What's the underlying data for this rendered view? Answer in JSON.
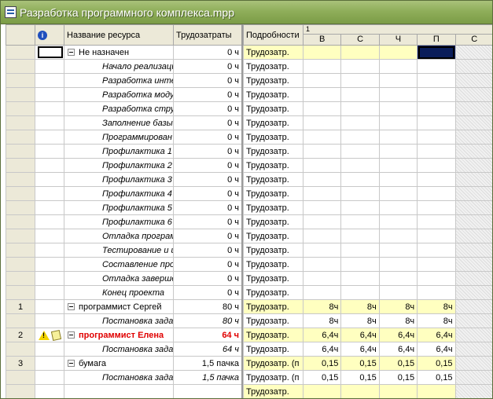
{
  "window": {
    "title": "Разработка программного комплекса.mpp"
  },
  "columns": {
    "indicator_icon": "info-icon",
    "name": "Название ресурса",
    "work": "Трудозатраты",
    "details": "Подробности",
    "week_number": "1",
    "days": [
      "В",
      "С",
      "Ч",
      "П",
      "С"
    ]
  },
  "rows": [
    {
      "id": "",
      "name": "Не назначен",
      "work": "0 ч",
      "detail": "Трудозатр.",
      "values": [
        "",
        "",
        "",
        ""
      ]
    },
    {
      "id": "",
      "name": "Начало реализаци",
      "work": "0 ч",
      "detail": "Трудозатр.",
      "values": [
        "",
        "",
        "",
        ""
      ]
    },
    {
      "id": "",
      "name": "Разработка инте",
      "work": "0 ч",
      "detail": "Трудозатр.",
      "values": [
        "",
        "",
        "",
        ""
      ]
    },
    {
      "id": "",
      "name": "Разработка моду",
      "work": "0 ч",
      "detail": "Трудозатр.",
      "values": [
        "",
        "",
        "",
        ""
      ]
    },
    {
      "id": "",
      "name": "Разработка стру",
      "work": "0 ч",
      "detail": "Трудозатр.",
      "values": [
        "",
        "",
        "",
        ""
      ]
    },
    {
      "id": "",
      "name": "Заполнение базы",
      "work": "0 ч",
      "detail": "Трудозатр.",
      "values": [
        "",
        "",
        "",
        ""
      ]
    },
    {
      "id": "",
      "name": "Программирован",
      "work": "0 ч",
      "detail": "Трудозатр.",
      "values": [
        "",
        "",
        "",
        ""
      ]
    },
    {
      "id": "",
      "name": "Профилактика 1",
      "work": "0 ч",
      "detail": "Трудозатр.",
      "values": [
        "",
        "",
        "",
        ""
      ]
    },
    {
      "id": "",
      "name": "Профилактика 2",
      "work": "0 ч",
      "detail": "Трудозатр.",
      "values": [
        "",
        "",
        "",
        ""
      ]
    },
    {
      "id": "",
      "name": "Профилактика 3",
      "work": "0 ч",
      "detail": "Трудозатр.",
      "values": [
        "",
        "",
        "",
        ""
      ]
    },
    {
      "id": "",
      "name": "Профилактика 4",
      "work": "0 ч",
      "detail": "Трудозатр.",
      "values": [
        "",
        "",
        "",
        ""
      ]
    },
    {
      "id": "",
      "name": "Профилактика 5",
      "work": "0 ч",
      "detail": "Трудозатр.",
      "values": [
        "",
        "",
        "",
        ""
      ]
    },
    {
      "id": "",
      "name": "Профилактика 6",
      "work": "0 ч",
      "detail": "Трудозатр.",
      "values": [
        "",
        "",
        "",
        ""
      ]
    },
    {
      "id": "",
      "name": "Отладка програм",
      "work": "0 ч",
      "detail": "Трудозатр.",
      "values": [
        "",
        "",
        "",
        ""
      ]
    },
    {
      "id": "",
      "name": "Тестирование и и",
      "work": "0 ч",
      "detail": "Трудозатр.",
      "values": [
        "",
        "",
        "",
        ""
      ]
    },
    {
      "id": "",
      "name": "Составление про",
      "work": "0 ч",
      "detail": "Трудозатр.",
      "values": [
        "",
        "",
        "",
        ""
      ]
    },
    {
      "id": "",
      "name": "Отладка заверше",
      "work": "0 ч",
      "detail": "Трудозатр.",
      "values": [
        "",
        "",
        "",
        ""
      ]
    },
    {
      "id": "",
      "name": "Конец проекта",
      "work": "0 ч",
      "detail": "Трудозатр.",
      "values": [
        "",
        "",
        "",
        ""
      ]
    },
    {
      "id": "1",
      "name": "программист Сергей",
      "work": "80 ч",
      "detail": "Трудозатр.",
      "values": [
        "8ч",
        "8ч",
        "8ч",
        "8ч"
      ]
    },
    {
      "id": "",
      "name": "Постановка задач",
      "work": "80 ч",
      "detail": "Трудозатр.",
      "values": [
        "8ч",
        "8ч",
        "8ч",
        "8ч"
      ]
    },
    {
      "id": "2",
      "name": "программист Елена",
      "work": "64 ч",
      "detail": "Трудозатр.",
      "values": [
        "6,4ч",
        "6,4ч",
        "6,4ч",
        "6,4ч"
      ]
    },
    {
      "id": "",
      "name": "Постановка задач",
      "work": "64 ч",
      "detail": "Трудозатр.",
      "values": [
        "6,4ч",
        "6,4ч",
        "6,4ч",
        "6,4ч"
      ]
    },
    {
      "id": "3",
      "name": "бумага",
      "work": "1,5 пачка",
      "detail": "Трудозатр. (п",
      "values": [
        "0,15",
        "0,15",
        "0,15",
        "0,15"
      ]
    },
    {
      "id": "",
      "name": "Постановка задач",
      "work": "1,5 пачка",
      "detail": "Трудозатр. (п",
      "values": [
        "0,15",
        "0,15",
        "0,15",
        "0,15"
      ]
    },
    {
      "id": "",
      "name": "",
      "work": "",
      "detail": "Трудозатр.",
      "values": [
        "",
        "",
        "",
        ""
      ]
    }
  ],
  "colors": {
    "title_bar": "#8fae5a",
    "highlight_row": "#ffffc0",
    "overallocated": "#e00000",
    "selected_cell": "#0a1d5a"
  }
}
